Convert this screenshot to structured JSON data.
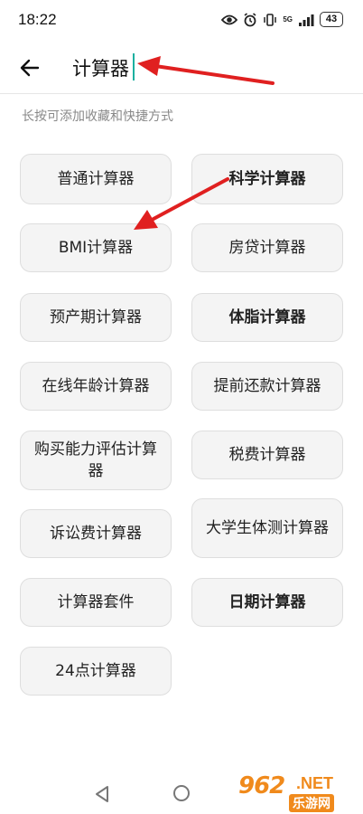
{
  "status_bar": {
    "time": "18:22",
    "network": "5G",
    "battery": "43"
  },
  "search": {
    "query": "计算器"
  },
  "hint": "长按可添加收藏和快捷方式",
  "calculators": [
    {
      "label": "普通计算器",
      "bold": false
    },
    {
      "label": "科学计算器",
      "bold": true
    },
    {
      "label": "BMI计算器",
      "bold": false
    },
    {
      "label": "房贷计算器",
      "bold": false
    },
    {
      "label": "预产期计算器",
      "bold": false
    },
    {
      "label": "体脂计算器",
      "bold": true
    },
    {
      "label": "在线年龄计算器",
      "bold": false
    },
    {
      "label": "提前还款计算器",
      "bold": false
    },
    {
      "label": "购买能力评估计算器",
      "bold": false
    },
    {
      "label": "税费计算器",
      "bold": false
    },
    {
      "label": "诉讼费计算器",
      "bold": false
    },
    {
      "label": "大学生体测计算器",
      "bold": false
    },
    {
      "label": "计算器套件",
      "bold": false
    },
    {
      "label": "日期计算器",
      "bold": true
    },
    {
      "label": "24点计算器",
      "bold": false
    }
  ],
  "watermark": {
    "number": "962",
    "domain": ".NET",
    "name": "乐游网"
  },
  "colors": {
    "annotation_arrow": "#e02020",
    "caret": "#1bb0a0",
    "watermark": "#f08a1c"
  },
  "icons": {
    "back": "arrow-left-icon",
    "nav_back": "triangle-back-icon",
    "nav_home": "circle-home-icon"
  }
}
